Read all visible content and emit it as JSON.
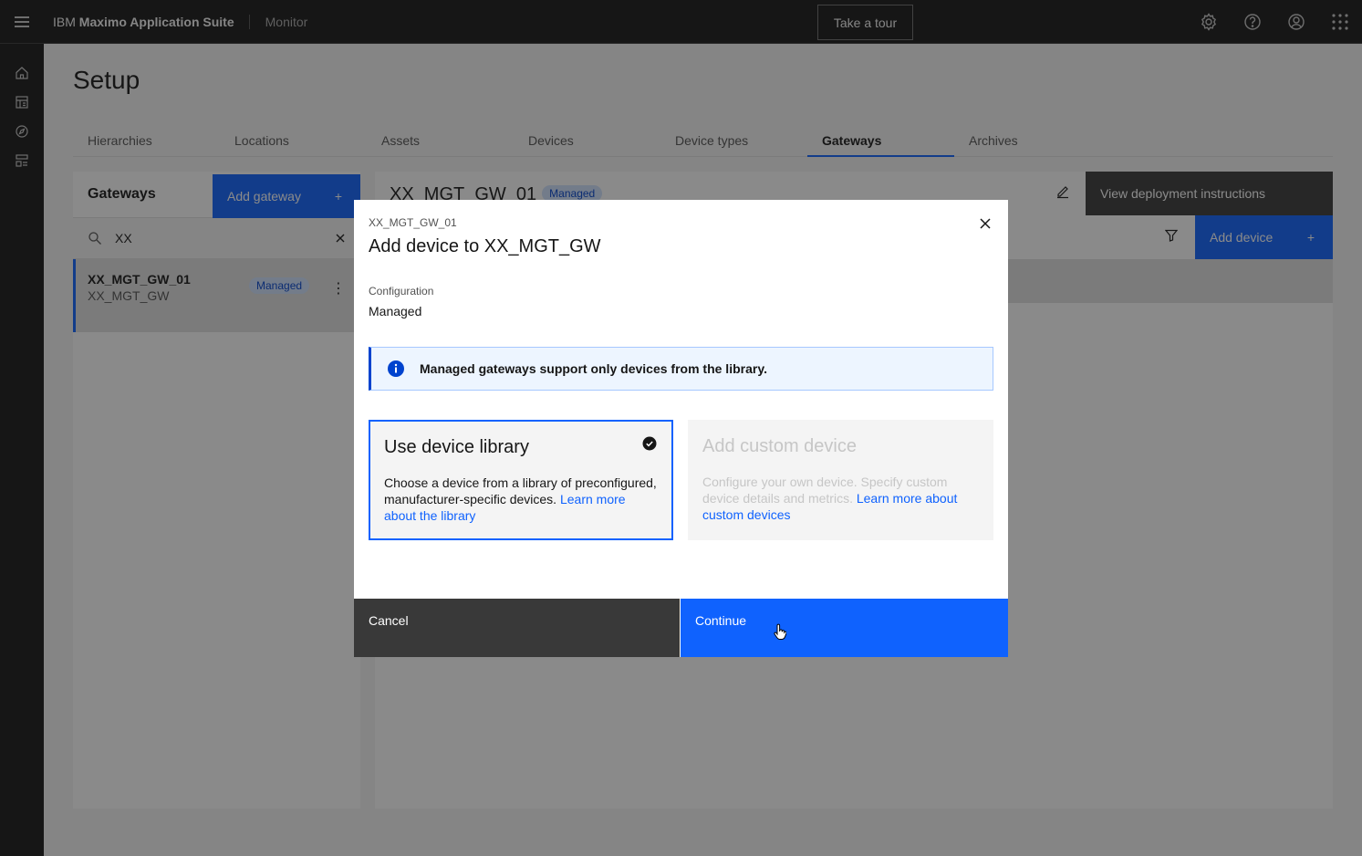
{
  "header": {
    "brand_ibm": "IBM ",
    "brand_suite": "Maximo Application Suite",
    "app_name": "Monitor",
    "tour_label": "Take a tour",
    "icons": [
      "settings-icon",
      "help-icon",
      "user-icon",
      "app-switcher-icon"
    ]
  },
  "rail": {
    "icons": [
      "home-icon",
      "dashboard-icon",
      "explore-icon",
      "setup-icon"
    ]
  },
  "page": {
    "title": "Setup"
  },
  "tabs": [
    {
      "label": "Hierarchies"
    },
    {
      "label": "Locations"
    },
    {
      "label": "Assets"
    },
    {
      "label": "Devices"
    },
    {
      "label": "Device types"
    },
    {
      "label": "Gateways",
      "active": true
    },
    {
      "label": "Archives"
    }
  ],
  "gateways_panel": {
    "title": "Gateways",
    "add_label": "Add gateway",
    "search_value": "XX",
    "items": [
      {
        "name": "XX_MGT_GW_01",
        "sub": "XX_MGT_GW",
        "tag": "Managed"
      }
    ]
  },
  "detail": {
    "title": "XX_MGT_GW_01",
    "tag": "Managed",
    "deploy_label": "View deployment instructions",
    "add_device_label": "Add device"
  },
  "modal": {
    "label": "XX_MGT_GW_01",
    "title": "Add device to XX_MGT_GW",
    "config_label": "Configuration",
    "config_value": "Managed",
    "notice": "Managed gateways support only devices from the library.",
    "tile_library": {
      "title": "Use device library",
      "desc": "Choose a device from a library of preconfigured, manufacturer-specific devices. ",
      "link": "Learn more about the library"
    },
    "tile_custom": {
      "title": "Add custom device",
      "desc": "Configure your own device. Specify custom device details and metrics. ",
      "link": "Learn more about custom devices"
    },
    "cancel_label": "Cancel",
    "continue_label": "Continue"
  },
  "colors": {
    "primary": "#0f62fe",
    "header": "#161616",
    "tag_bg": "#d0e2ff",
    "tag_fg": "#0043ce"
  }
}
